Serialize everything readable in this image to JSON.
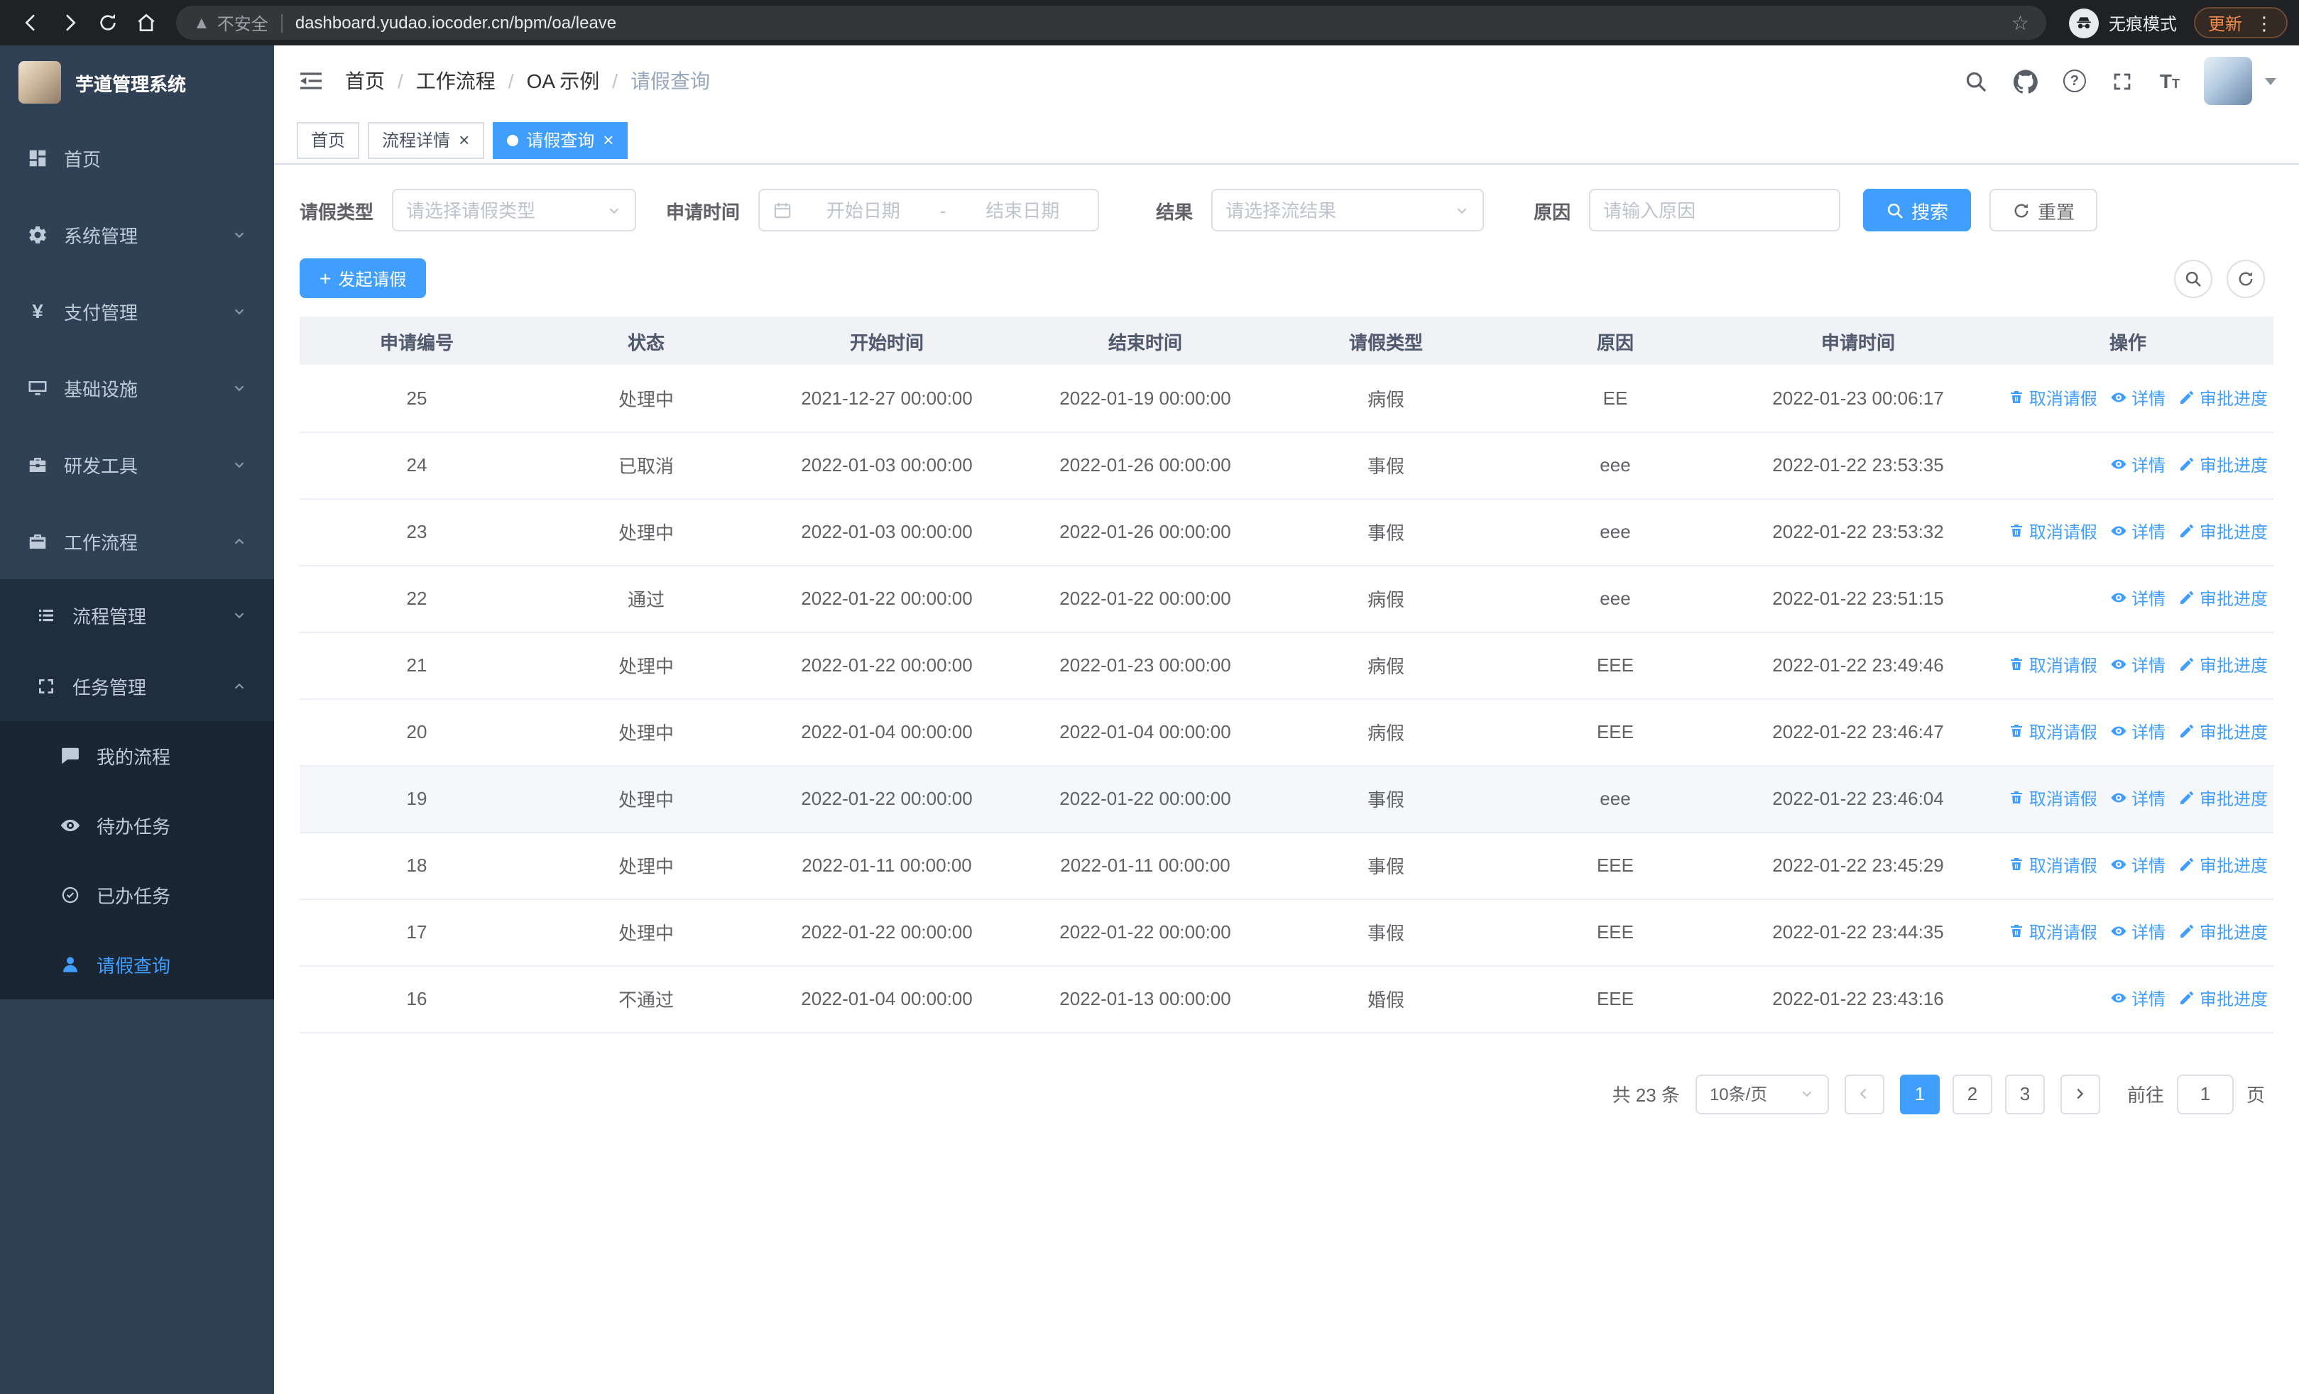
{
  "colors": {
    "accent": "#409eff",
    "sidebar_bg": "#304156",
    "sidebar_sub_bg": "#1f2d3d"
  },
  "browser": {
    "url": "dashboard.yudao.iocoder.cn/bpm/oa/leave",
    "security_label": "不安全",
    "incognito_label": "无痕模式",
    "update_label": "更新"
  },
  "sidebar": {
    "logo_title": "芋道管理系统",
    "items": [
      {
        "label": "首页"
      },
      {
        "label": "系统管理"
      },
      {
        "label": "支付管理"
      },
      {
        "label": "基础设施"
      },
      {
        "label": "研发工具"
      },
      {
        "label": "工作流程"
      },
      {
        "label": "流程管理"
      },
      {
        "label": "任务管理"
      },
      {
        "label": "我的流程"
      },
      {
        "label": "待办任务"
      },
      {
        "label": "已办任务"
      },
      {
        "label": "请假查询"
      }
    ]
  },
  "header": {
    "breadcrumb": [
      "首页",
      "工作流程",
      "OA 示例",
      "请假查询"
    ]
  },
  "tabs": [
    {
      "label": "首页"
    },
    {
      "label": "流程详情"
    },
    {
      "label": "请假查询"
    }
  ],
  "filters": {
    "leave_type_label": "请假类型",
    "leave_type_placeholder": "请选择请假类型",
    "apply_time_label": "申请时间",
    "start_placeholder": "开始日期",
    "range_separator": "-",
    "end_placeholder": "结束日期",
    "result_label": "结果",
    "result_placeholder": "请选择流结果",
    "reason_label": "原因",
    "reason_placeholder": "请输入原因",
    "search_label": "搜索",
    "reset_label": "重置"
  },
  "toolbar": {
    "create_label": "发起请假"
  },
  "table": {
    "columns": [
      "申请编号",
      "状态",
      "开始时间",
      "结束时间",
      "请假类型",
      "原因",
      "申请时间",
      "操作"
    ],
    "ops_labels": {
      "cancel": "取消请假",
      "detail": "详情",
      "progress": "审批进度"
    },
    "rows": [
      {
        "id": "25",
        "status": "处理中",
        "start": "2021-12-27 00:00:00",
        "end": "2022-01-19 00:00:00",
        "type": "病假",
        "reason": "EE",
        "apply_time": "2022-01-23 00:06:17",
        "ops": [
          "cancel",
          "detail",
          "progress"
        ],
        "hover": false
      },
      {
        "id": "24",
        "status": "已取消",
        "start": "2022-01-03 00:00:00",
        "end": "2022-01-26 00:00:00",
        "type": "事假",
        "reason": "eee",
        "apply_time": "2022-01-22 23:53:35",
        "ops": [
          "detail",
          "progress"
        ],
        "hover": false
      },
      {
        "id": "23",
        "status": "处理中",
        "start": "2022-01-03 00:00:00",
        "end": "2022-01-26 00:00:00",
        "type": "事假",
        "reason": "eee",
        "apply_time": "2022-01-22 23:53:32",
        "ops": [
          "cancel",
          "detail",
          "progress"
        ],
        "hover": false
      },
      {
        "id": "22",
        "status": "通过",
        "start": "2022-01-22 00:00:00",
        "end": "2022-01-22 00:00:00",
        "type": "病假",
        "reason": "eee",
        "apply_time": "2022-01-22 23:51:15",
        "ops": [
          "detail",
          "progress"
        ],
        "hover": false
      },
      {
        "id": "21",
        "status": "处理中",
        "start": "2022-01-22 00:00:00",
        "end": "2022-01-23 00:00:00",
        "type": "病假",
        "reason": "EEE",
        "apply_time": "2022-01-22 23:49:46",
        "ops": [
          "cancel",
          "detail",
          "progress"
        ],
        "hover": false
      },
      {
        "id": "20",
        "status": "处理中",
        "start": "2022-01-04 00:00:00",
        "end": "2022-01-04 00:00:00",
        "type": "病假",
        "reason": "EEE",
        "apply_time": "2022-01-22 23:46:47",
        "ops": [
          "cancel",
          "detail",
          "progress"
        ],
        "hover": false
      },
      {
        "id": "19",
        "status": "处理中",
        "start": "2022-01-22 00:00:00",
        "end": "2022-01-22 00:00:00",
        "type": "事假",
        "reason": "eee",
        "apply_time": "2022-01-22 23:46:04",
        "ops": [
          "cancel",
          "detail",
          "progress"
        ],
        "hover": true
      },
      {
        "id": "18",
        "status": "处理中",
        "start": "2022-01-11 00:00:00",
        "end": "2022-01-11 00:00:00",
        "type": "事假",
        "reason": "EEE",
        "apply_time": "2022-01-22 23:45:29",
        "ops": [
          "cancel",
          "detail",
          "progress"
        ],
        "hover": false
      },
      {
        "id": "17",
        "status": "处理中",
        "start": "2022-01-22 00:00:00",
        "end": "2022-01-22 00:00:00",
        "type": "事假",
        "reason": "EEE",
        "apply_time": "2022-01-22 23:44:35",
        "ops": [
          "cancel",
          "detail",
          "progress"
        ],
        "hover": false
      },
      {
        "id": "16",
        "status": "不通过",
        "start": "2022-01-04 00:00:00",
        "end": "2022-01-13 00:00:00",
        "type": "婚假",
        "reason": "EEE",
        "apply_time": "2022-01-22 23:43:16",
        "ops": [
          "detail",
          "progress"
        ],
        "hover": false
      }
    ]
  },
  "pagination": {
    "total_text": "共 23 条",
    "page_size_label": "10条/页",
    "pages": [
      "1",
      "2",
      "3"
    ],
    "current_page": "1",
    "goto_label": "前往",
    "goto_value": "1",
    "page_unit": "页"
  }
}
